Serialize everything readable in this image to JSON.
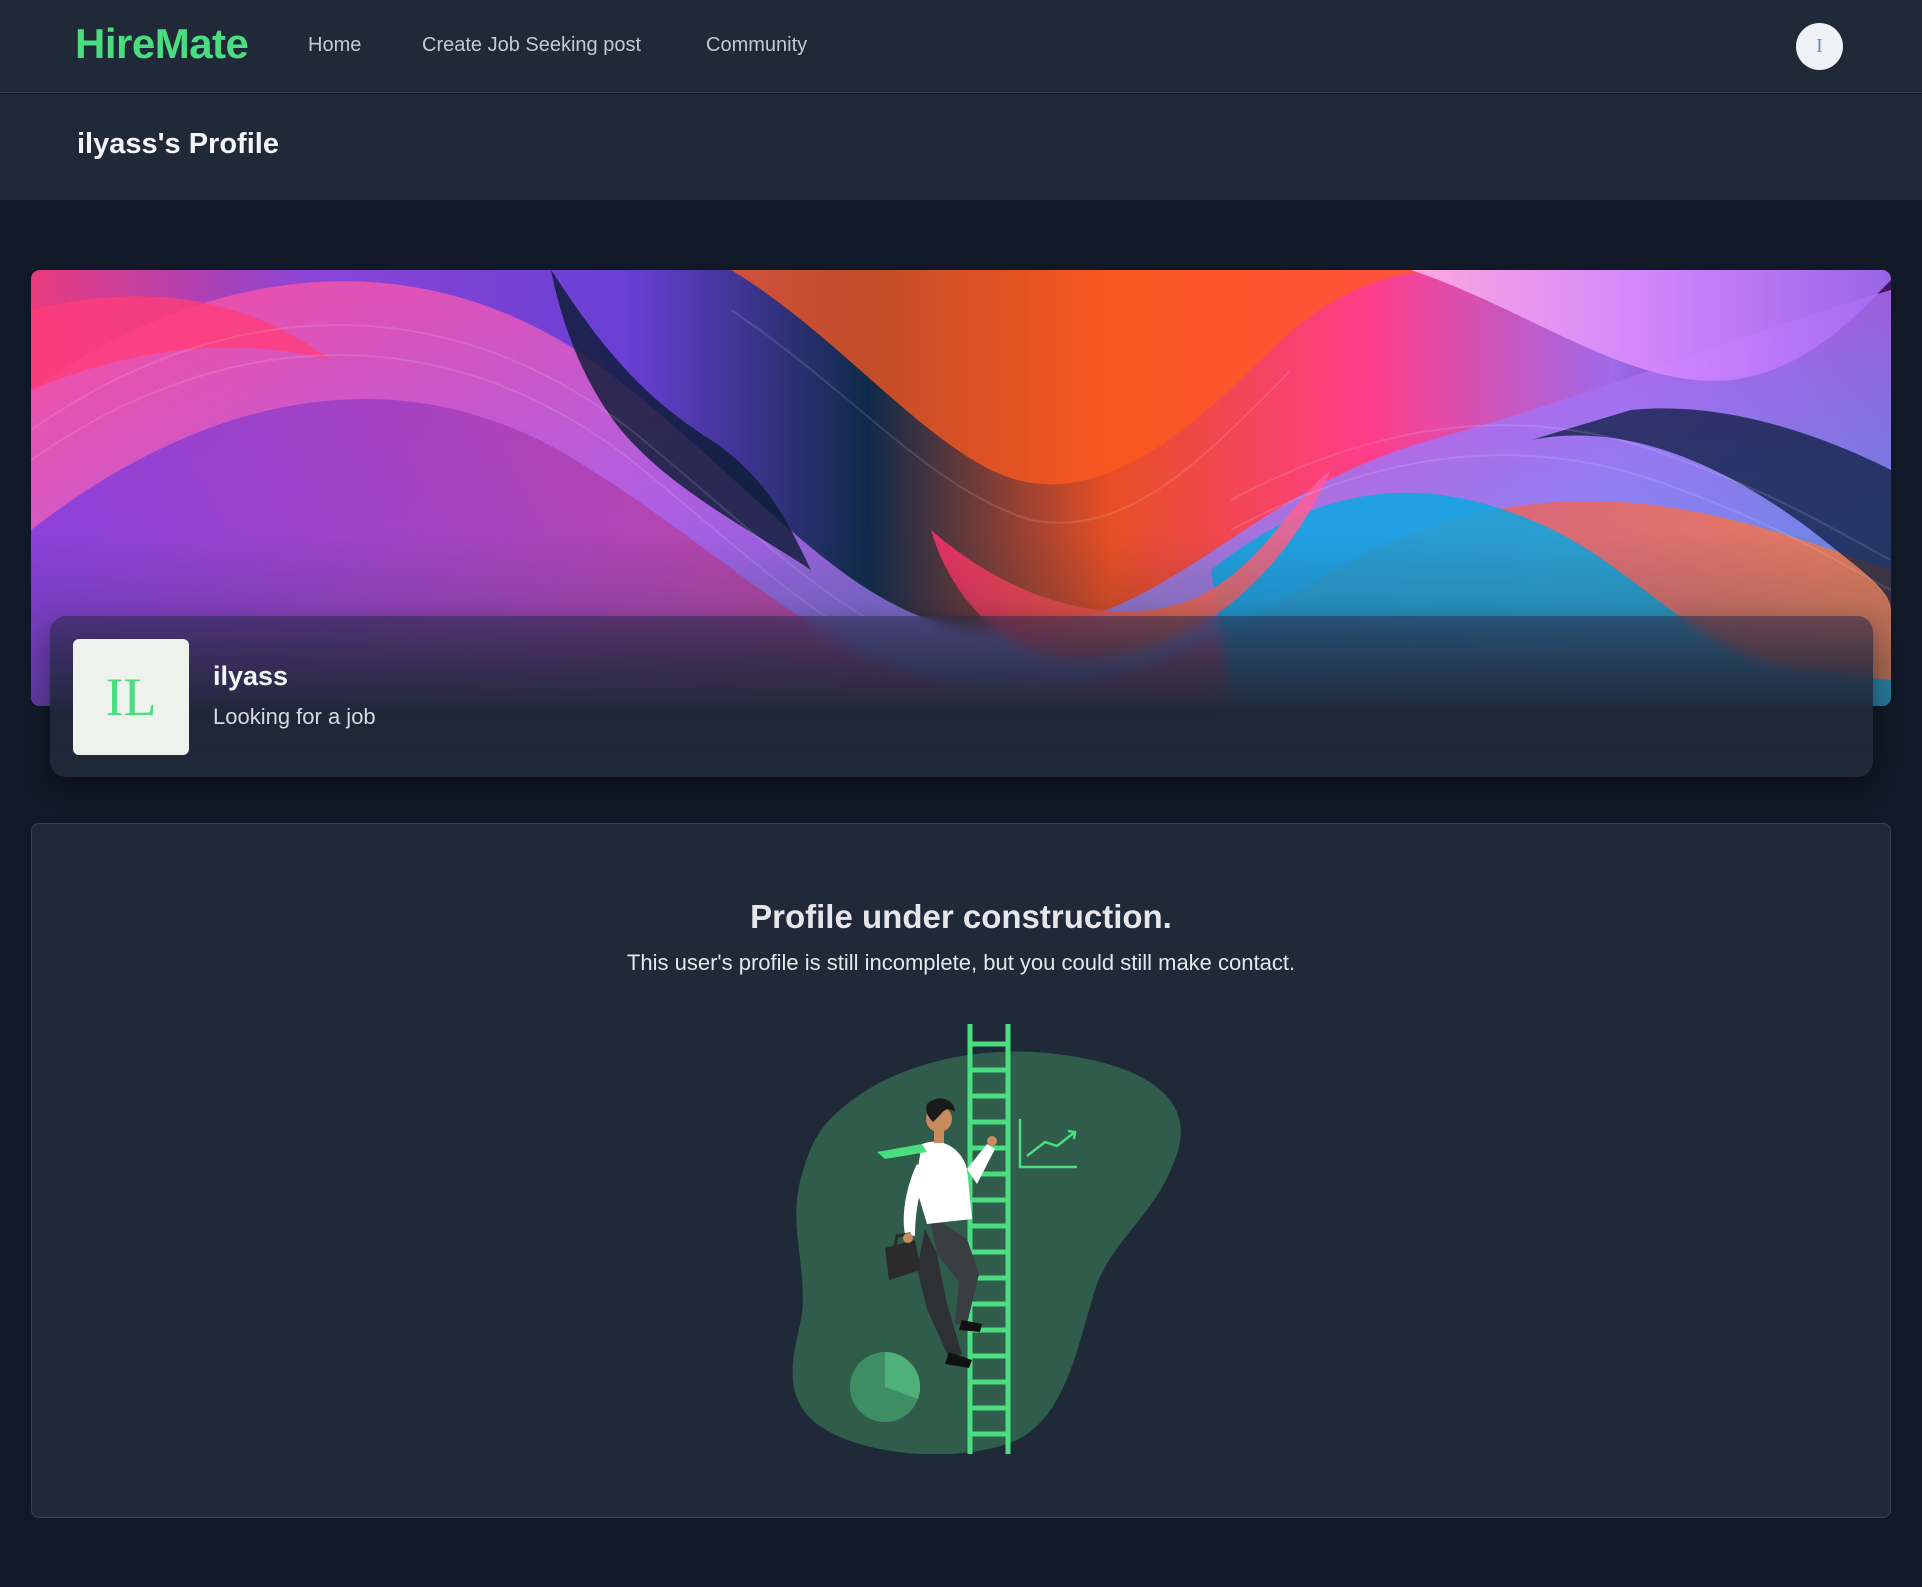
{
  "nav": {
    "brand": "HireMate",
    "links": [
      "Home",
      "Create Job Seeking post",
      "Community"
    ],
    "avatar_initial": "I"
  },
  "header": {
    "title": "ilyass's Profile"
  },
  "profile": {
    "initials": "IL",
    "name": "ilyass",
    "status": "Looking for a job"
  },
  "notice": {
    "title": "Profile under construction.",
    "subtitle": "This user's profile is still incomplete, but you could still make contact."
  },
  "colors": {
    "accent": "#4ade80",
    "background": "#111827",
    "surface": "#1f2937"
  }
}
